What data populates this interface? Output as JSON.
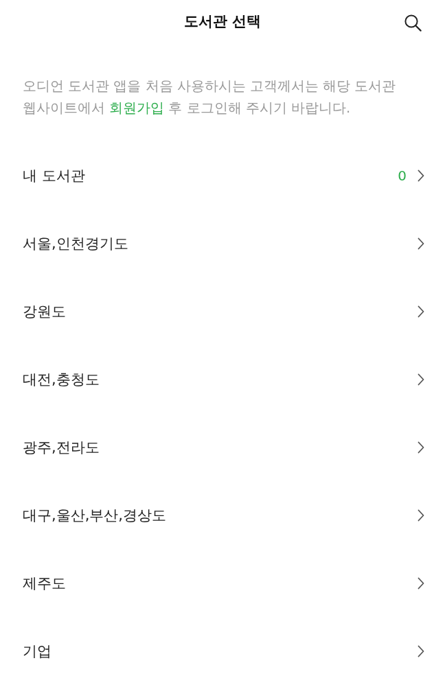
{
  "header": {
    "title": "도서관 선택"
  },
  "notice": {
    "text_before": "오디언 도서관 앱을 처음 사용하시는 고객께서는 해당 도서관 웹사이트에서 ",
    "link": "회원가입",
    "text_after": " 후 로그인해 주시기 바랍니다."
  },
  "library_groups": [
    {
      "label": "내 도서관",
      "count": "0"
    },
    {
      "label": "서울,인천경기도"
    },
    {
      "label": "강원도"
    },
    {
      "label": "대전,충청도"
    },
    {
      "label": "광주,전라도"
    },
    {
      "label": "대구,울산,부산,경상도"
    },
    {
      "label": "제주도"
    },
    {
      "label": "기업"
    }
  ]
}
